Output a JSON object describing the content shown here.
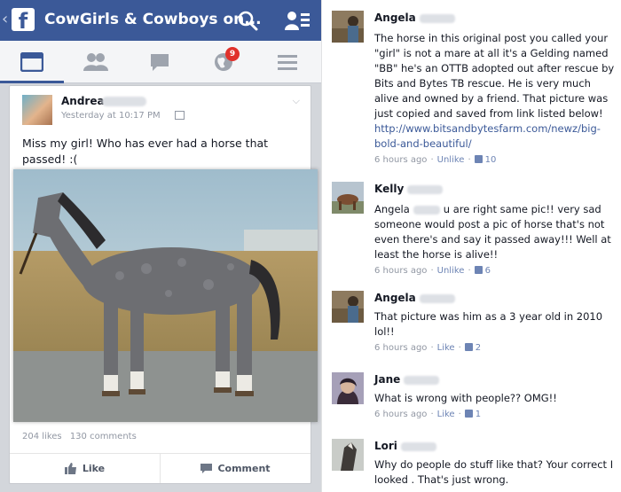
{
  "app": {
    "title": "CowGirls & Cowboys on...",
    "back_glyph": "‹",
    "logo_glyph": "f",
    "icons": {
      "search": "search-icon",
      "friends": "friend-requests-icon"
    }
  },
  "tabs": [
    {
      "name": "news-feed",
      "icon": "newsfeed-icon"
    },
    {
      "name": "friends",
      "icon": "friends-icon"
    },
    {
      "name": "messages",
      "icon": "messages-icon"
    },
    {
      "name": "notifications",
      "icon": "globe-icon",
      "badge": "9"
    },
    {
      "name": "menu",
      "icon": "menu-icon"
    }
  ],
  "post": {
    "author": "Andrea",
    "time": "Yesterday at 10:17 PM",
    "text": "Miss my girl! Who has ever had a horse that passed! :(",
    "likes": "204 likes",
    "comments": "130 comments",
    "like_label": "Like",
    "comment_label": "Comment"
  },
  "comments": [
    {
      "name": "Angela",
      "text": "The horse in this original post you called your \"girl\" is not a mare at all it's a Gelding named \"BB\" he's an OTTB adopted out after rescue by Bits and Bytes TB rescue. He is very much alive and owned by a friend. That picture was just copied and saved from link listed below!",
      "link": "http://www.bitsandbytesfarm.com/newz/big-bold-and-beautiful/",
      "time": "6 hours ago",
      "action": "Unlike",
      "likes": "10"
    },
    {
      "name": "Kelly",
      "mention": "Angela",
      "text": "u are right same pic!! very sad someone would post a pic of horse that's not even there's and say it passed away!!! Well at least the horse is alive!!",
      "time": "6 hours ago",
      "action": "Unlike",
      "likes": "6"
    },
    {
      "name": "Angela",
      "text": "That picture was him as a 3 year old in 2010 lol!!",
      "time": "6 hours ago",
      "action": "Like",
      "likes": "2"
    },
    {
      "name": "Jane",
      "text": "What is wrong with people?? OMG!!",
      "time": "6 hours ago",
      "action": "Like",
      "likes": "1"
    },
    {
      "name": "Lori",
      "text": "Why do people do stuff like that? Your correct I looked . That's just wrong."
    }
  ],
  "colors": {
    "brand": "#3b5998",
    "badge": "#e0312b",
    "meta": "#9197a3",
    "link": "#3b5998"
  }
}
